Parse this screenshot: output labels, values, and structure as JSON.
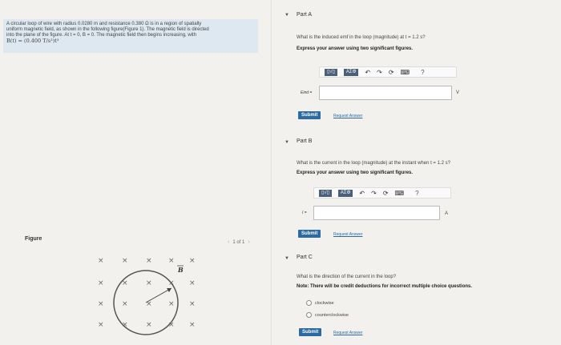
{
  "problem": {
    "text_line1": "A circular loop of wire with radius 0.0280 m and resistance 0.380 Ω is in a region of spatially",
    "text_line2": "uniform magnetic field, as shown in the following figure(Figure 1). The magnetic field is directed",
    "text_line3": "into the plane of the figure. At t = 0, B = 0. The magnetic field then begins increasing, with",
    "equation": "B(t) = (0.400 T/s³)t³"
  },
  "figure": {
    "label": "Figure",
    "pager_text": "1 of 1",
    "field_symbol": "×",
    "b_label": "B"
  },
  "part_a": {
    "title": "Part A",
    "question": "What is the induced emf in the loop (magnitude) at t = 1.2 s?",
    "instruction": "Express your answer using two significant figures.",
    "answer_label": "Eind =",
    "unit": "V",
    "submit_label": "Submit",
    "request_label": "Request Answer"
  },
  "part_b": {
    "title": "Part B",
    "question": "What is the current in the loop (magnitude) at the instant when t = 1.2 s?",
    "instruction": "Express your answer using two significant figures.",
    "answer_label": "I =",
    "unit": "A",
    "submit_label": "Submit",
    "request_label": "Request Answer"
  },
  "part_c": {
    "title": "Part C",
    "question": "What is the direction of the current in the loop?",
    "note": "Note: There will be credit deductions for incorrect multiple choice questions.",
    "options": [
      "clockwise",
      "counterclockwise"
    ],
    "submit_label": "Submit",
    "request_label": "Request Answer"
  },
  "toolbar": {
    "template_label": "▯√▯",
    "greek_label": "ΑΣΦ",
    "undo_icon": "↶",
    "redo_icon": "↷",
    "reset_icon": "⟳",
    "keyboard_icon": "⌨",
    "help_icon": "?"
  }
}
